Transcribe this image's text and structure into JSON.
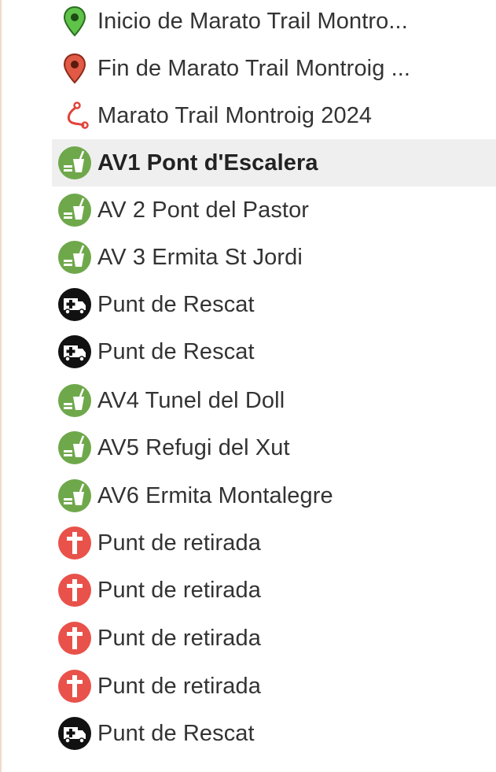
{
  "items": [
    {
      "label": "Inicio de Marato Trail Montro...",
      "icon": "green-map-pin-icon",
      "selected": false
    },
    {
      "label": "Fin de Marato Trail Montroig ...",
      "icon": "red-map-pin-icon",
      "selected": false
    },
    {
      "label": "Marato Trail Montroig 2024",
      "icon": "route-track-icon",
      "selected": false
    },
    {
      "label": "AV1 Pont d'Escalera",
      "icon": "refreshment-station-icon",
      "selected": true
    },
    {
      "label": "AV 2 Pont del Pastor",
      "icon": "refreshment-station-icon",
      "selected": false
    },
    {
      "label": "AV 3 Ermita St Jordi",
      "icon": "refreshment-station-icon",
      "selected": false
    },
    {
      "label": "Punt de Rescat",
      "icon": "ambulance-icon",
      "selected": false
    },
    {
      "label": "Punt de Rescat",
      "icon": "ambulance-icon",
      "selected": false
    },
    {
      "label": "AV4 Tunel del Doll",
      "icon": "refreshment-station-icon",
      "selected": false
    },
    {
      "label": "AV5 Refugi del Xut",
      "icon": "refreshment-station-icon",
      "selected": false
    },
    {
      "label": "AV6 Ermita Montalegre",
      "icon": "refreshment-station-icon",
      "selected": false
    },
    {
      "label": "Punt de retirada",
      "icon": "withdrawal-point-icon",
      "selected": false
    },
    {
      "label": "Punt de retirada",
      "icon": "withdrawal-point-icon",
      "selected": false
    },
    {
      "label": "Punt de retirada",
      "icon": "withdrawal-point-icon",
      "selected": false
    },
    {
      "label": "Punt de retirada",
      "icon": "withdrawal-point-icon",
      "selected": false
    },
    {
      "label": "Punt de Rescat",
      "icon": "ambulance-icon",
      "selected": false
    }
  ],
  "colors": {
    "green_pin": "#5fc34a",
    "red_pin": "#e05a45",
    "route": "#e0443a",
    "refreshment": "#6ea84b",
    "ambulance": "#111111",
    "withdrawal": "#e8524a",
    "selected_background": "#efefef"
  }
}
